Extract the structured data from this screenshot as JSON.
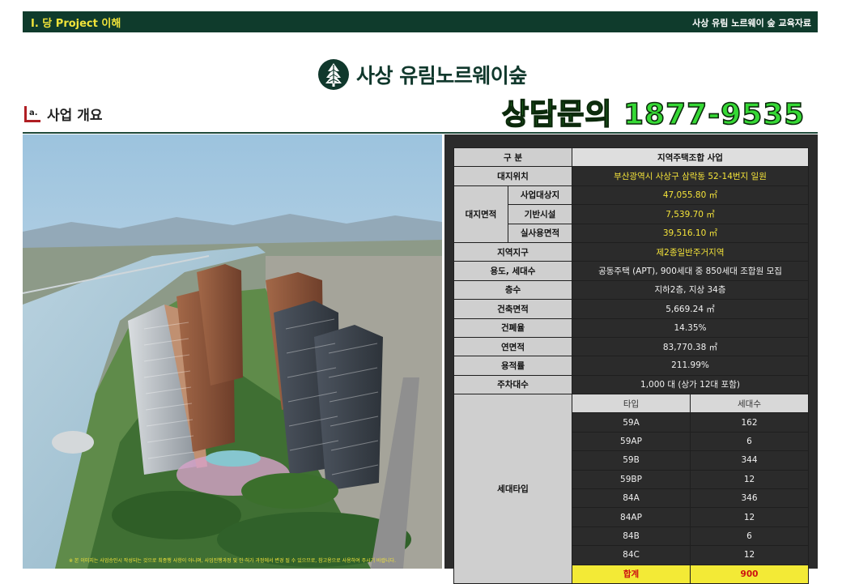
{
  "header": {
    "section": "Ⅰ. 당 Project 이해",
    "doc_title": "사상 유림 노르웨이 숲 교육자료"
  },
  "logo": {
    "text": "사상 유림노르웨이숲",
    "icon": "tree-icon"
  },
  "section": {
    "icon_letter": "a.",
    "title": "사업 개요"
  },
  "phone": "상담문의 1877-9535",
  "photo": {
    "icon": "apartment-rendering",
    "caption": "※ 본 이미지는 사업승인시 작성되는 것으로 최종행 사항이 아니며, 사업진행과정 및 인·허가 과정에서 변경 될 수 있으므로, 참고용으로 사용하여 주시기 바랍니다."
  },
  "spec": {
    "header": [
      "구 분",
      "지역주택조합 사업"
    ],
    "location": [
      "대지위치",
      "부산광역시 사상구 삼락동 52-14번지 일원"
    ],
    "site_label": "대지면적",
    "site": [
      [
        "사업대상지",
        "47,055.80 ㎡"
      ],
      [
        "기반시설",
        "7,539.70 ㎡"
      ],
      [
        "실사용면적",
        "39,516.10 ㎡"
      ]
    ],
    "rows": [
      [
        "지역지구",
        "제2종일반주거지역"
      ],
      [
        "용도, 세대수",
        "공동주택 (APT), 900세대 중 850세대 조합원 모집"
      ],
      [
        "층수",
        "지하2층, 지상 34층"
      ],
      [
        "건축면적",
        "5,669.24 ㎡"
      ],
      [
        "건폐율",
        "14.35%"
      ],
      [
        "연면적",
        "83,770.38 ㎡"
      ],
      [
        "용적률",
        "211.99%"
      ],
      [
        "주차대수",
        "1,000 대 (상가 12대 포함)"
      ]
    ],
    "types_label": "세대타입",
    "types_header": [
      "타입",
      "세대수"
    ],
    "types": [
      [
        "59A",
        "162"
      ],
      [
        "59AP",
        "6"
      ],
      [
        "59B",
        "344"
      ],
      [
        "59BP",
        "12"
      ],
      [
        "84A",
        "346"
      ],
      [
        "84AP",
        "12"
      ],
      [
        "84B",
        "6"
      ],
      [
        "84C",
        "12"
      ]
    ],
    "total": [
      "합계",
      "900"
    ]
  },
  "colors": {
    "header_bg": "#0f3b2c",
    "header_text": "#f0e33a",
    "phone": "#36d935",
    "highlight": "#f4e33a",
    "total_text": "#cc1111"
  }
}
